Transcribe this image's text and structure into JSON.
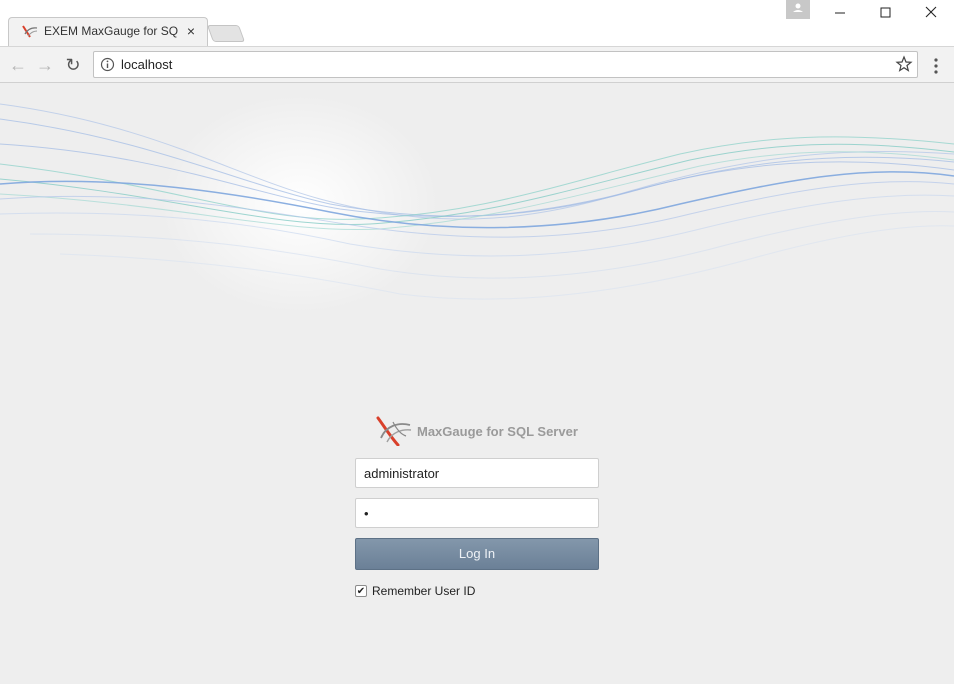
{
  "browser": {
    "tab_title": "EXEM MaxGauge for SQL",
    "tab_close": "×",
    "address": "localhost",
    "back": "←",
    "forward": "→",
    "reload": "↻",
    "colors": {
      "tab_bg": "#f2f2f2",
      "toolbar_bg": "#f2f2f2"
    }
  },
  "login": {
    "product_name": "MaxGauge for SQL Server",
    "username_value": "administrator",
    "password_value": "•",
    "login_button": "Log In",
    "remember_label": "Remember User ID",
    "remember_checked": true,
    "remember_check_glyph": "✔",
    "colors": {
      "button": "#7589a0",
      "logo_red": "#d9402b",
      "product_text": "#9a9a9a"
    }
  },
  "icons": [
    "exem-favicon-icon",
    "close-icon",
    "profile-icon",
    "minimize-icon",
    "maximize-icon",
    "close-window-icon",
    "back-icon",
    "forward-icon",
    "reload-icon",
    "info-icon",
    "star-icon",
    "menu-icon",
    "exem-logo-icon",
    "checkbox-check-icon"
  ]
}
